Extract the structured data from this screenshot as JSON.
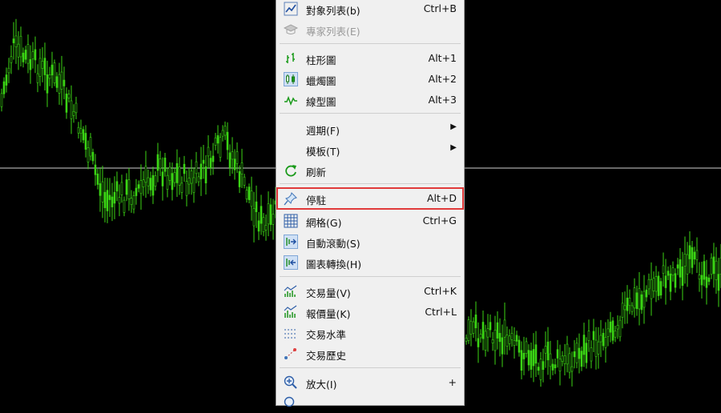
{
  "colors": {
    "candle": "#3bd414",
    "background": "#000000",
    "menu_bg": "#f0f0f0",
    "highlight": "#e03a3a"
  },
  "menu": {
    "items": [
      {
        "id": "symbol-list",
        "label": "對象列表(b)",
        "shortcut": "Ctrl+B",
        "icon": "chart-line-icon"
      },
      {
        "id": "expert-list",
        "label": "專家列表(E)",
        "shortcut": "",
        "icon": "graduation-cap-icon",
        "disabled": true
      },
      {
        "id": "bar-chart",
        "label": "柱形圖",
        "shortcut": "Alt+1",
        "icon": "bar-chart-icon"
      },
      {
        "id": "candle-chart",
        "label": "蠟燭圖",
        "shortcut": "Alt+2",
        "icon": "candlestick-icon"
      },
      {
        "id": "line-chart",
        "label": "線型圖",
        "shortcut": "Alt+3",
        "icon": "line-chart-icon"
      },
      {
        "id": "periods",
        "label": "週期(F)",
        "shortcut": "",
        "submenu": true
      },
      {
        "id": "templates",
        "label": "模板(T)",
        "shortcut": "",
        "submenu": true
      },
      {
        "id": "refresh",
        "label": "刷新",
        "shortcut": "",
        "icon": "refresh-icon"
      },
      {
        "id": "dock",
        "label": "停駐",
        "shortcut": "Alt+D",
        "icon": "pin-icon",
        "highlighted": true
      },
      {
        "id": "grid",
        "label": "網格(G)",
        "shortcut": "Ctrl+G",
        "icon": "grid-icon"
      },
      {
        "id": "autoscroll",
        "label": "自動滾動(S)",
        "shortcut": "",
        "icon": "autoscroll-icon"
      },
      {
        "id": "chart-shift",
        "label": "圖表轉換(H)",
        "shortcut": "",
        "icon": "chart-shift-icon"
      },
      {
        "id": "volumes",
        "label": "交易量(V)",
        "shortcut": "Ctrl+K",
        "icon": "volumes-icon"
      },
      {
        "id": "tick-volumes",
        "label": "報價量(K)",
        "shortcut": "Ctrl+L",
        "icon": "tick-volumes-icon"
      },
      {
        "id": "trade-levels",
        "label": "交易水準",
        "shortcut": "",
        "icon": "trade-levels-icon"
      },
      {
        "id": "trade-history",
        "label": "交易歷史",
        "shortcut": "",
        "icon": "trade-history-icon"
      },
      {
        "id": "zoom-in",
        "label": "放大(I)",
        "shortcut": "+",
        "icon": "zoom-in-icon"
      }
    ]
  }
}
